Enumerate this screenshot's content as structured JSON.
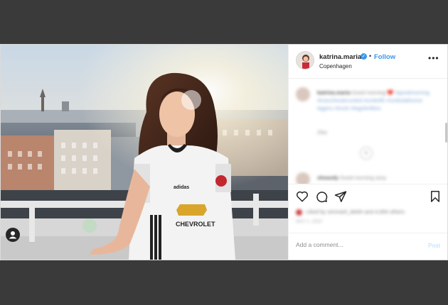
{
  "post": {
    "username": "katrina.maria",
    "separator": "•",
    "follow_label": "Follow",
    "location": "Copenhagen",
    "more_icon": "ellipsis-icon",
    "verified_icon": "verified-badge-icon"
  },
  "photo": {
    "user_tag_icon": "person-tag-icon",
    "jersey_brand": "adidas",
    "jersey_sponsor": "CHEVROLET"
  },
  "comments": [
    {
      "username": "katrina.maria",
      "text": "Good morning ❤️",
      "hashtags": "#goodmorning #manchesterunited #unitedfc #unitedathome #ggmu #mufc #tagsforlikes",
      "meta": "25w"
    },
    {
      "username": "sheasdy",
      "text": "Good morning sexy",
      "meta": ""
    }
  ],
  "actions": {
    "like_icon": "heart-icon",
    "comment_icon": "comment-icon",
    "share_icon": "paper-plane-icon",
    "save_icon": "bookmark-icon",
    "likes_text": "Liked by simmaril_deleh and 4,994 others",
    "date": "MAY 1, 2020"
  },
  "comment_box": {
    "placeholder": "Add a comment...",
    "post_label": "Post"
  },
  "colors": {
    "accent": "#3897f0",
    "backdrop": "#3a3a3a",
    "border": "#dbdbdb"
  }
}
